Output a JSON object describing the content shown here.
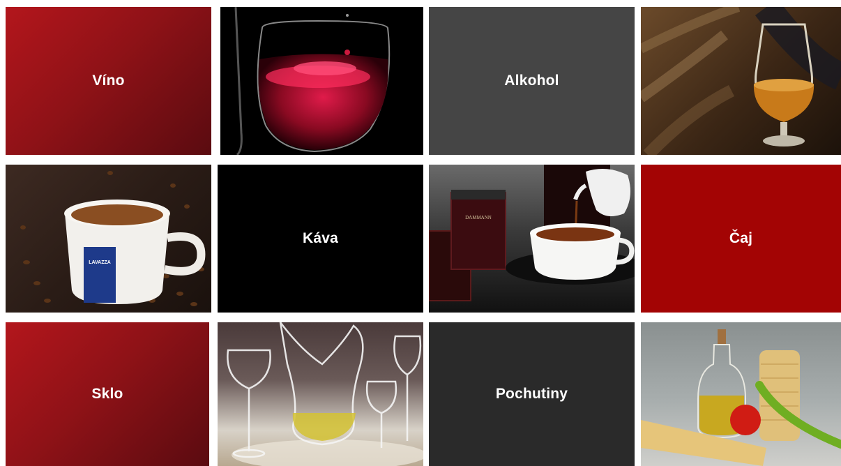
{
  "colors": {
    "wine_tile": "#9b1419",
    "alcohol_tile": "#454545",
    "coffee_tile": "#000000",
    "tea_tile": "#a30404",
    "glass_tile": "#9b1419",
    "spices_tile": "#2a2a2a"
  },
  "categories": [
    {
      "label": "Víno"
    },
    {
      "label": "Alkohol"
    },
    {
      "label": "Káva"
    },
    {
      "label": "Čaj"
    },
    {
      "label": "Sklo"
    },
    {
      "label": "Pochutiny"
    }
  ],
  "images": {
    "wine": {
      "icon": "wine-glass-rose-icon"
    },
    "whisky": {
      "icon": "whisky-glass-icon"
    },
    "coffee": {
      "icon": "coffee-cup-icon",
      "cup_brand": "LAVAZZA"
    },
    "tea": {
      "icon": "tea-cup-icon",
      "tin_brand": "DAMMANN"
    },
    "glassware": {
      "icon": "glassware-decanter-icon"
    },
    "pasta": {
      "icon": "pasta-oil-icon"
    }
  }
}
